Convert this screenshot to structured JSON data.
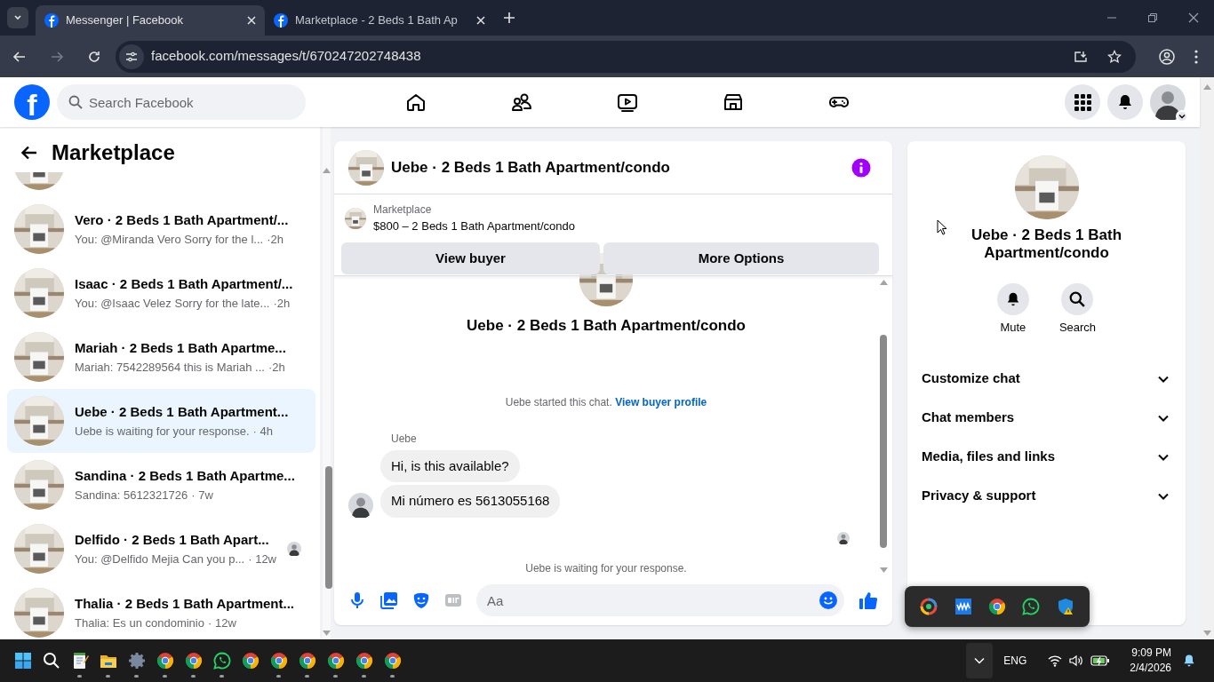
{
  "browser": {
    "tabs": [
      {
        "title": "Messenger | Facebook",
        "selected": true
      },
      {
        "title": "Marketplace - 2 Beds 1 Bath Ap",
        "selected": false
      }
    ],
    "url": "facebook.com/messages/t/670247202748438"
  },
  "header": {
    "logo": "f",
    "search_placeholder": "Search Facebook"
  },
  "sidebar": {
    "title": "Marketplace",
    "conversations": [
      {
        "title": "Vero · 2 Beds 1 Bath Apartment/...",
        "preview": "You: @Miranda Vero Sorry for the l...",
        "time": "·2h",
        "selected": false,
        "seen": false
      },
      {
        "title": "Isaac · 2 Beds 1 Bath Apartment/...",
        "preview": "You: @Isaac Velez Sorry for the late...",
        "time": "·2h",
        "selected": false,
        "seen": false
      },
      {
        "title": "Mariah · 2 Beds 1 Bath Apartme...",
        "preview": "Mariah: 7542289564 this is Mariah ...",
        "time": "·2h",
        "selected": false,
        "seen": false
      },
      {
        "title": "Uebe · 2 Beds 1 Bath Apartment...",
        "preview": "Uebe is waiting for your response.",
        "time": "· 4h",
        "selected": true,
        "seen": false
      },
      {
        "title": "Sandina · 2 Beds 1 Bath Apartme...",
        "preview": "Sandina: 5612321726",
        "time": "· 7w",
        "selected": false,
        "seen": false
      },
      {
        "title": "Delfido · 2 Beds 1 Bath Apart...",
        "preview": "You: @Delfido Mejia Can you p...",
        "time": "· 12w",
        "selected": false,
        "seen": true
      },
      {
        "title": "Thalia · 2 Beds 1 Bath Apartment...",
        "preview": "Thalia: Es un condominio",
        "time": "· 12w",
        "selected": false,
        "seen": false
      }
    ]
  },
  "chat": {
    "title": "Uebe · 2 Beds 1 Bath Apartment/condo",
    "listing": {
      "label": "Marketplace",
      "text": "$800 – 2 Beds 1 Bath Apartment/condo"
    },
    "buttons": [
      "View buyer",
      "More Options"
    ],
    "intro_title": "Uebe · 2 Beds 1 Bath Apartment/condo",
    "started": "Uebe started this chat.",
    "started_link": "View buyer profile",
    "sender": "Uebe",
    "messages": [
      "Hi, is this available?",
      "Mi número es 5613055168"
    ],
    "status": "Uebe is waiting for your response.",
    "composer_placeholder": "Aa"
  },
  "details": {
    "title": "Uebe · 2 Beds 1 Bath Apartment/condo",
    "actions": [
      {
        "kind": "mute",
        "label": "Mute"
      },
      {
        "kind": "search",
        "label": "Search"
      }
    ],
    "sections": [
      {
        "label": "Customize chat",
        "expanded": false
      },
      {
        "label": "Chat members",
        "expanded": false
      },
      {
        "label": "Media, files and links",
        "expanded": false
      },
      {
        "label": "Privacy & support",
        "expanded": false
      }
    ]
  },
  "taskbar": {
    "apps": [
      {
        "kind": "start",
        "running": false
      },
      {
        "kind": "search",
        "running": false
      },
      {
        "kind": "notepad",
        "running": true
      },
      {
        "kind": "folder",
        "running": true
      },
      {
        "kind": "settings",
        "running": true
      },
      {
        "kind": "chrome",
        "running": true
      },
      {
        "kind": "chrome",
        "running": true
      },
      {
        "kind": "whatsapp",
        "running": true
      },
      {
        "kind": "chrome",
        "running": false
      },
      {
        "kind": "chrome",
        "running": true
      },
      {
        "kind": "chrome",
        "running": true
      },
      {
        "kind": "chrome",
        "running": true
      },
      {
        "kind": "chrome",
        "running": true
      },
      {
        "kind": "chrome",
        "running": true
      }
    ],
    "tray_popup": [
      {
        "kind": "swirl"
      },
      {
        "kind": "wave"
      },
      {
        "kind": "chrome"
      },
      {
        "kind": "whatsapp"
      },
      {
        "kind": "shield"
      }
    ],
    "language": "ENG",
    "time": "9:09 PM",
    "date": "2/4/2026"
  }
}
